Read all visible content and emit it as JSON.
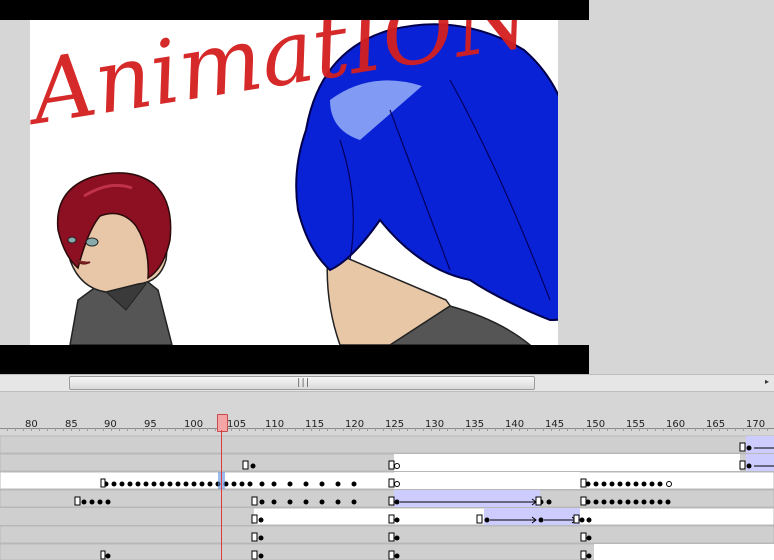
{
  "canvas": {
    "scribble_text": "AnimatION"
  },
  "timeline": {
    "ruler_labels": [
      "80",
      "85",
      "90",
      "95",
      "100",
      "105",
      "110",
      "115",
      "120",
      "125",
      "130",
      "135",
      "140",
      "145",
      "150",
      "155",
      "160",
      "165",
      "170"
    ],
    "current_frame": 103,
    "scroll_grip": "|||",
    "scroll_arrow": "▸"
  },
  "colors": {
    "scribble_red": "#d41f1f",
    "hair_blue": "#0a22d6",
    "hair_red": "#8c0f22",
    "tween_fill": "#ccccff",
    "playhead": "#e03a3a"
  }
}
